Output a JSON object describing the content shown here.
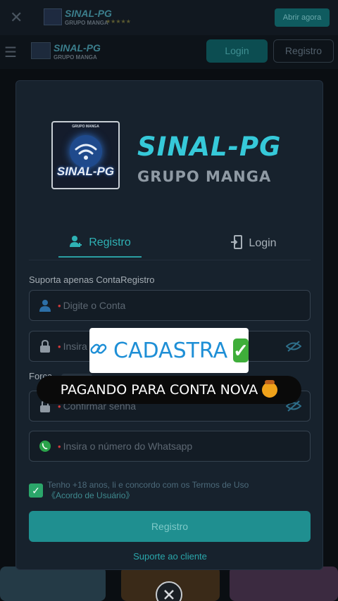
{
  "app_header": {
    "title": "SINAL-PG",
    "subtitle": "GRUPO MANGA",
    "open_button": "Abrir agora"
  },
  "nav": {
    "title": "SINAL-PG",
    "subtitle": "GRUPO MANGA",
    "login_button": "Login",
    "register_button": "Registro"
  },
  "modal": {
    "logo": {
      "tag": "GRUPO MANGA",
      "brand": "SINAL-PG"
    },
    "title": "SINAL-PG",
    "subtitle": "GRUPO MANGA",
    "tabs": [
      {
        "label": "Registro",
        "active": true
      },
      {
        "label": "Login",
        "active": false
      }
    ],
    "section_label": "Suporta apenas ContaRegistro",
    "fields": {
      "account_placeholder": "Digite o Conta",
      "password_placeholder": "Insira a senha",
      "force_label": "Força",
      "confirm_placeholder": "Confirmar senha",
      "whatsapp_placeholder": "Insira o número do Whatsapp"
    },
    "terms_text": "Tenho +18 anos, li e concordo com os Termos de Uso",
    "terms_link": "《Acordo de Usuário》",
    "terms_checked": true,
    "submit_label": "Registro",
    "support_label": "Suporte ao cliente"
  },
  "overlays": {
    "sticker_top": "CADASTRA",
    "sticker_bottom": "PAGANDO PARA CONTA NOVA"
  },
  "colors": {
    "accent": "#2fb2b5",
    "title_cyan": "#36c9d9",
    "modal_bg": "#17222d",
    "check_green": "#2ba66a"
  }
}
